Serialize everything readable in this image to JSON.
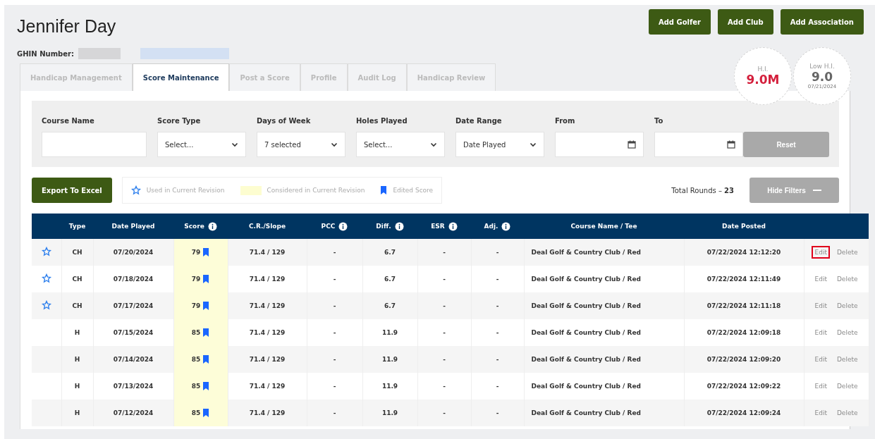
{
  "header": {
    "name": "Jennifer Day",
    "ghin_label": "GHIN Number:",
    "buttons": [
      "Add Golfer",
      "Add Club",
      "Add Association"
    ]
  },
  "indexes": [
    {
      "label": "H.I.",
      "value": "9.0M",
      "kind": "current"
    },
    {
      "label": "Low H.I.",
      "value": "9.0",
      "date": "07/21/2024",
      "kind": "low"
    }
  ],
  "tabs": [
    {
      "label": "Handicap Management",
      "selected": false
    },
    {
      "label": "Score Maintenance",
      "selected": true
    },
    {
      "label": "Post a Score",
      "selected": false
    },
    {
      "label": "Profile",
      "selected": false
    },
    {
      "label": "Audit Log",
      "selected": false
    },
    {
      "label": "Handicap Review",
      "selected": false
    }
  ],
  "filters": [
    {
      "label": "Course Name",
      "kind": "text"
    },
    {
      "label": "Score Type",
      "kind": "select",
      "value": "Select..."
    },
    {
      "label": "Days of Week",
      "kind": "select",
      "value": "7 selected"
    },
    {
      "label": "Holes Played",
      "kind": "select",
      "value": "Select..."
    },
    {
      "label": "Date Range",
      "kind": "select",
      "value": "Date Played"
    },
    {
      "label": "From",
      "kind": "date"
    },
    {
      "label": "To",
      "kind": "date"
    }
  ],
  "reset_button": "Reset",
  "export_button": "Export To Excel",
  "legend": [
    "Used in Current Revision",
    "Considered in Current Revision",
    "Edited Score"
  ],
  "total_rounds": {
    "label": "Total Rounds – ",
    "value": "23"
  },
  "hide_filters_button": "Hide Filters",
  "table": {
    "columns": [
      {
        "label": "Type",
        "info": false
      },
      {
        "label": "Date Played",
        "info": false
      },
      {
        "label": "Score",
        "info": true
      },
      {
        "label": "C.R./Slope",
        "info": false
      },
      {
        "label": "PCC",
        "info": true
      },
      {
        "label": "Diff.",
        "info": true
      },
      {
        "label": "ESR",
        "info": true
      },
      {
        "label": "Adj.",
        "info": true
      },
      {
        "label": "Course Name / Tee",
        "info": false
      },
      {
        "label": "Date Posted",
        "info": false
      }
    ],
    "rows": [
      {
        "used": true,
        "type": "CH",
        "date": "07/20/2024",
        "score": "79",
        "edited": true,
        "cr_slope": "71.4 / 129",
        "pcc": "-",
        "diff": "6.7",
        "esr": "-",
        "adj": "-",
        "course": "Deal Golf & Country Club / Red",
        "posted": "07/22/2024 12:12:20",
        "edit": "Edit",
        "delete": "Delete",
        "highlighted": true
      },
      {
        "used": true,
        "type": "CH",
        "date": "07/18/2024",
        "score": "79",
        "edited": true,
        "cr_slope": "71.4 / 129",
        "pcc": "-",
        "diff": "6.7",
        "esr": "-",
        "adj": "-",
        "course": "Deal Golf & Country Club / Red",
        "posted": "07/22/2024 12:11:49",
        "edit": "Edit",
        "delete": "Delete",
        "highlighted": false
      },
      {
        "used": true,
        "type": "CH",
        "date": "07/17/2024",
        "score": "79",
        "edited": true,
        "cr_slope": "71.4 / 129",
        "pcc": "-",
        "diff": "6.7",
        "esr": "-",
        "adj": "-",
        "course": "Deal Golf & Country Club / Red",
        "posted": "07/22/2024 12:11:18",
        "edit": "Edit",
        "delete": "Delete",
        "highlighted": false
      },
      {
        "used": false,
        "type": "H",
        "date": "07/15/2024",
        "score": "85",
        "edited": true,
        "cr_slope": "71.4 / 129",
        "pcc": "-",
        "diff": "11.9",
        "esr": "-",
        "adj": "-",
        "course": "Deal Golf & Country Club / Red",
        "posted": "07/22/2024 12:09:18",
        "edit": "Edit",
        "delete": "Delete",
        "highlighted": false
      },
      {
        "used": false,
        "type": "H",
        "date": "07/14/2024",
        "score": "85",
        "edited": true,
        "cr_slope": "71.4 / 129",
        "pcc": "-",
        "diff": "11.9",
        "esr": "-",
        "adj": "-",
        "course": "Deal Golf & Country Club / Red",
        "posted": "07/22/2024 12:09:20",
        "edit": "Edit",
        "delete": "Delete",
        "highlighted": false
      },
      {
        "used": false,
        "type": "H",
        "date": "07/13/2024",
        "score": "85",
        "edited": true,
        "cr_slope": "71.4 / 129",
        "pcc": "-",
        "diff": "11.9",
        "esr": "-",
        "adj": "-",
        "course": "Deal Golf & Country Club / Red",
        "posted": "07/22/2024 12:09:22",
        "edit": "Edit",
        "delete": "Delete",
        "highlighted": false
      },
      {
        "used": false,
        "type": "H",
        "date": "07/12/2024",
        "score": "85",
        "edited": true,
        "cr_slope": "71.4 / 129",
        "pcc": "-",
        "diff": "11.9",
        "esr": "-",
        "adj": "-",
        "course": "Deal Golf & Country Club / Red",
        "posted": "07/22/2024 12:09:24",
        "edit": "Edit",
        "delete": "Delete",
        "highlighted": false
      }
    ]
  }
}
